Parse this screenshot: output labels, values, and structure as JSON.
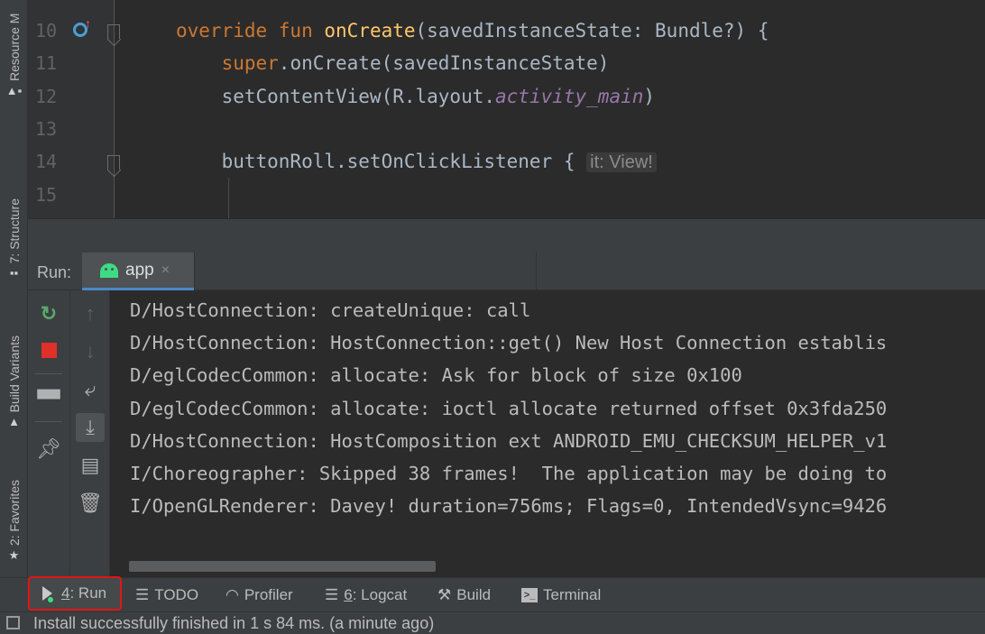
{
  "side_tabs": {
    "resource": "Resource M",
    "structure": "7: Structure",
    "build_variants": "Build Variants",
    "favorites": "2: Favorites"
  },
  "editor": {
    "lines": [
      {
        "num": "10",
        "parts": [
          {
            "t": "override fun ",
            "c": "kw"
          },
          {
            "t": "onCreate",
            "c": "fn"
          },
          {
            "t": "(savedInstanceState: Bundle?) {",
            "c": ""
          }
        ]
      },
      {
        "num": "11",
        "parts": [
          {
            "t": "    super",
            "c": "kw"
          },
          {
            "t": ".onCreate(savedInstanceState)",
            "c": ""
          }
        ]
      },
      {
        "num": "12",
        "parts": [
          {
            "t": "    setContentView(R.layout.",
            "c": ""
          },
          {
            "t": "activity_main",
            "c": "it"
          },
          {
            "t": ")",
            "c": ""
          }
        ]
      },
      {
        "num": "13",
        "parts": []
      },
      {
        "num": "14",
        "parts": [
          {
            "t": "    buttonRoll.setOnClickListener { ",
            "c": ""
          },
          {
            "t": "it: View!",
            "c": "hint"
          }
        ]
      },
      {
        "num": "15",
        "parts": []
      }
    ]
  },
  "run_window": {
    "label": "Run:",
    "tab": "app",
    "close": "×"
  },
  "console": {
    "lines": [
      "D/HostConnection: createUnique: call",
      "D/HostConnection: HostConnection::get() New Host Connection establis",
      "D/eglCodecCommon: allocate: Ask for block of size 0x100",
      "D/eglCodecCommon: allocate: ioctl allocate returned offset 0x3fda250",
      "D/HostConnection: HostComposition ext ANDROID_EMU_CHECKSUM_HELPER_v1",
      "I/Choreographer: Skipped 38 frames!  The application may be doing to",
      "I/OpenGLRenderer: Davey! duration=756ms; Flags=0, IntendedVsync=9426"
    ]
  },
  "bottom_tabs": {
    "run_num": "4",
    "run": ": Run",
    "todo": "TODO",
    "profiler": "Profiler",
    "logcat_num": "6",
    "logcat": ": Logcat",
    "build": "Build",
    "terminal": "Terminal"
  },
  "status": {
    "text": "Install successfully finished in 1 s 84 ms. (a minute ago)"
  },
  "icons": {
    "rerun": "rerun-icon",
    "stop": "stop-icon",
    "layout": "layout-icon",
    "pin": "pin-icon",
    "up": "up-arrow-icon",
    "down": "down-arrow-icon",
    "wrap": "soft-wrap-icon",
    "scroll_end": "scroll-to-end-icon",
    "print": "print-icon",
    "trash": "trash-icon"
  },
  "colors": {
    "keyword": "#cc7832",
    "function": "#ffc66d",
    "italic_field": "#9876aa",
    "run_tab_highlight": "#e01616",
    "android_green": "#3ddc84"
  }
}
